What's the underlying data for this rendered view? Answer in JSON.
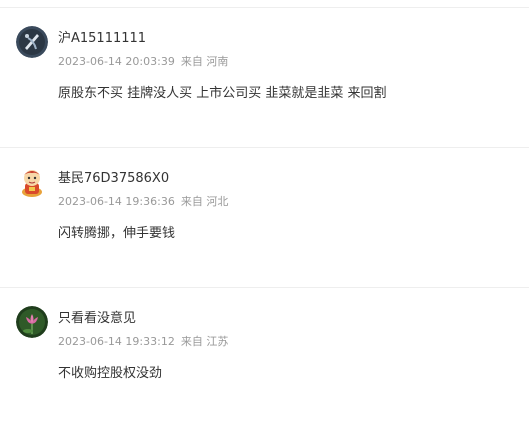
{
  "comments": [
    {
      "username": "沪A15111111",
      "datetime": "2023-06-14 20:03:39",
      "location": "来自 河南",
      "content": "原股东不买 挂牌没人买 上市公司买 韭菜就是韭菜 来回割",
      "avatar": "dark-abstract-avatar"
    },
    {
      "username": "基民76D37586X0",
      "datetime": "2023-06-14 19:36:36",
      "location": "来自 河北",
      "content": "闪转腾挪，伸手要钱",
      "avatar": "cartoon-figure-avatar"
    },
    {
      "username": "只看看没意见",
      "datetime": "2023-06-14 19:33:12",
      "location": "来自 江苏",
      "content": "不收购控股权没劲",
      "avatar": "lotus-flower-avatar"
    }
  ],
  "colors": {
    "text": "#333333",
    "meta": "#999999",
    "divider": "#eeeeee"
  }
}
